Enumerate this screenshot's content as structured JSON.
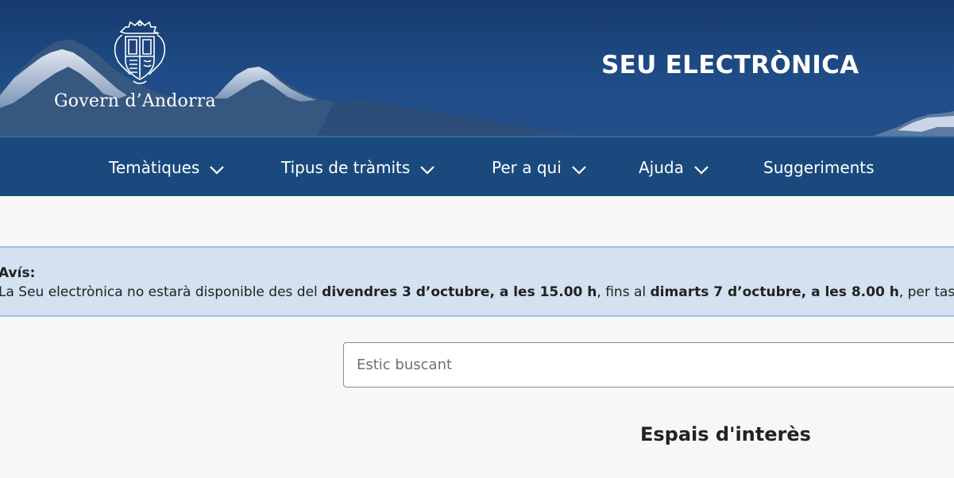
{
  "header": {
    "logo_text": "Govern d’Andorra",
    "site_title": "SEU ELECTRÒNICA"
  },
  "nav": {
    "items": [
      {
        "label": "Temàtiques",
        "icon": "chevron-down-icon"
      },
      {
        "label": "Tipus de tràmits",
        "icon": "chevron-down-icon"
      },
      {
        "label": "Per a qui",
        "icon": "chevron-down-icon"
      },
      {
        "label": "Ajuda",
        "icon": "chevron-down-icon"
      },
      {
        "label": "Suggeriments"
      }
    ]
  },
  "notice": {
    "title": "Avís:",
    "text_1": "La Seu electrònica no estarà disponible des del ",
    "bold_1": "divendres 3 d’octubre, a les 15.00 h",
    "text_2": ", fins al ",
    "bold_2": "dimarts 7 d’octubre, a les 8.00 h",
    "text_3": ", per tasq"
  },
  "search": {
    "placeholder": "Estic buscant",
    "value": ""
  },
  "sections": {
    "interest_title": "Espais d'interès"
  },
  "colors": {
    "banner": "#1f4c86",
    "navbar": "#1a4a7d",
    "notice_bg": "#d3e1f0",
    "notice_border": "#9ec0e6",
    "page_bg": "#f7f7f7"
  }
}
